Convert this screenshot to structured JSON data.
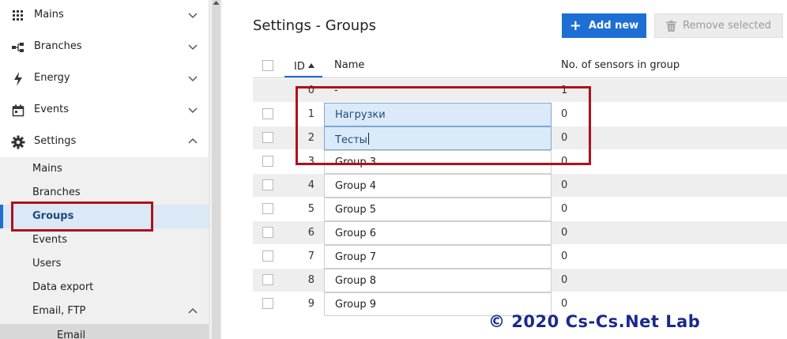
{
  "sidebar": {
    "items": [
      {
        "label": "Mains",
        "icon": "grid-icon",
        "expanded": false
      },
      {
        "label": "Branches",
        "icon": "branches-icon",
        "expanded": false
      },
      {
        "label": "Energy",
        "icon": "lightning-icon",
        "expanded": false
      },
      {
        "label": "Events",
        "icon": "calendar-icon",
        "expanded": false
      },
      {
        "label": "Settings",
        "icon": "gear-icon",
        "expanded": true
      }
    ],
    "settings_sub": [
      {
        "label": "Mains",
        "active": false
      },
      {
        "label": "Branches",
        "active": false
      },
      {
        "label": "Groups",
        "active": true
      },
      {
        "label": "Events",
        "active": false
      },
      {
        "label": "Users",
        "active": false
      },
      {
        "label": "Data export",
        "active": false
      },
      {
        "label": "Email, FTP",
        "active": false,
        "expanded": true
      }
    ],
    "email_sub": {
      "label": "Email"
    }
  },
  "main": {
    "title": "Settings - Groups",
    "add_button": "Add new",
    "remove_button": "Remove selected",
    "columns": {
      "id": "ID",
      "name": "Name",
      "count": "No. of sensors in group"
    },
    "sort": {
      "column": "ID",
      "direction": "asc"
    },
    "rows": [
      {
        "id": "0",
        "name": "-",
        "count": "1",
        "editable": false
      },
      {
        "id": "1",
        "name": "Нагрузки",
        "count": "0",
        "editable": true,
        "selected": true
      },
      {
        "id": "2",
        "name": "Тесты",
        "count": "0",
        "editable": true,
        "selected": true,
        "editing": true
      },
      {
        "id": "3",
        "name": "Group 3",
        "count": "0",
        "editable": true
      },
      {
        "id": "4",
        "name": "Group 4",
        "count": "0",
        "editable": true
      },
      {
        "id": "5",
        "name": "Group 5",
        "count": "0",
        "editable": true
      },
      {
        "id": "6",
        "name": "Group 6",
        "count": "0",
        "editable": true
      },
      {
        "id": "7",
        "name": "Group 7",
        "count": "0",
        "editable": true
      },
      {
        "id": "8",
        "name": "Group 8",
        "count": "0",
        "editable": true
      },
      {
        "id": "9",
        "name": "Group 9",
        "count": "0",
        "editable": true
      }
    ]
  },
  "watermark": "© 2020 Cs-Cs.Net Lab",
  "colors": {
    "accent": "#1d6fd3",
    "highlight": "#b0101c",
    "active_bg": "#dbe8f6",
    "watermark": "#1a2a8c"
  }
}
